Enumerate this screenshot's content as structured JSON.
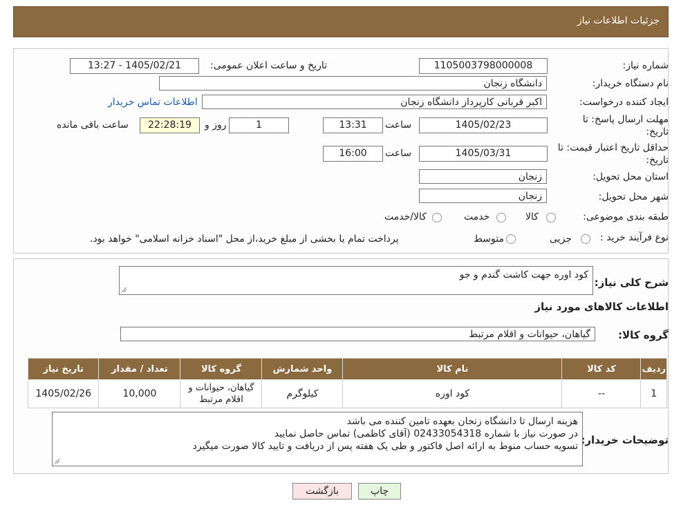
{
  "header": {
    "title": "جزئیات اطلاعات نیاز"
  },
  "form": {
    "need_number_label": "شماره نیاز:",
    "need_number": "1105003798000008",
    "announce_label": "تاریخ و ساعت اعلان عمومی:",
    "announce_value": "1405/02/21 - 13:27",
    "buyer_org_label": "نام دستگاه خریدار:",
    "buyer_org": "دانشگاه زنجان",
    "creator_label": "ایجاد کننده درخواست:",
    "creator": "اکبر قربانی کارپرداز دانشگاه زنجان",
    "contact_link": "اطلاعات تماس خریدار",
    "reply_deadline_label_1": "مهلت ارسال پاسخ: تا",
    "reply_deadline_label_2": "تاریخ:",
    "reply_date": "1405/02/23",
    "time_label": "ساعت",
    "reply_time": "13:31",
    "days": "1",
    "day_and_label": "روز و",
    "remaining_time": "22:28:19",
    "remaining_label": "ساعت باقی مانده",
    "validity_label_1": "حداقل تاریخ اعتبار قیمت: تا",
    "validity_label_2": "تاریخ:",
    "validity_date": "1405/03/31",
    "validity_time": "16:00",
    "province_label": "استان محل تحویل:",
    "province": "زنجان",
    "city_label": "شهر محل تحویل:",
    "city": "زنجان",
    "category_label": "طبقه بندی موضوعی:",
    "category_options": [
      "کالا",
      "خدمت",
      "کالا/خدمت"
    ],
    "process_label": "نوع فرآیند خرید :",
    "process_options": [
      "جزیی",
      "متوسط"
    ],
    "process_note": "پرداخت تمام یا بخشی از مبلغ خرید،از محل \"اسناد خزانه اسلامی\" خواهد بود."
  },
  "details": {
    "summary_label": "شرح کلی نیاز:",
    "summary": "کود اوره جهت کاشت گندم و جو",
    "goods_info_title": "اطلاعات کالاهای مورد نیاز",
    "group_label": "گروه کالا:",
    "group_value": "گیاهان، حیوانات و اقلام مرتبط",
    "table": {
      "headers": [
        "ردیف",
        "کد کالا",
        "نام کالا",
        "واحد شمارش",
        "گروه کالا",
        "تعداد / مقدار",
        "تاریخ نیاز"
      ],
      "rows": [
        [
          "1",
          "--",
          "کود اوره",
          "کیلوگرم",
          "گیاهان، حیوانات و اقلام مرتبط",
          "10,000",
          "1405/02/26"
        ]
      ]
    },
    "buyer_notes_label": "توضیحات خریدار:",
    "buyer_notes": [
      "هزینه ارسال تا دانشگاه زنجان بعهده تامین کننده می باشد",
      "در صورت نیاز با شماره 02433054318 (آقای کاظمی) تماس حاصل نمایید",
      "تسویه حساب منوط به ارائه اصل فاکتور و طی یک هفته پس از دریافت و تایید کالا صورت میگیرد"
    ]
  },
  "buttons": {
    "print": "چاپ",
    "back": "بازگشت"
  },
  "colors": {
    "header_bg": "#8b6a3f",
    "link": "#1a5ea8",
    "remaining_bg": "#ffffd8",
    "print_bg": "#e6f7e0",
    "back_bg": "#fbe4e4"
  }
}
